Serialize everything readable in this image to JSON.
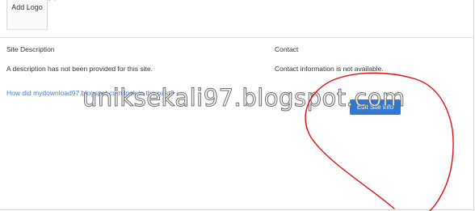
{
  "logo": {
    "plus_glyph": "+",
    "label": "Add Logo"
  },
  "top_fragment": "y          p",
  "site_description": {
    "heading": "Site Description",
    "text": "A description has not been provided for this site."
  },
  "contact": {
    "heading": "Contact",
    "text": "Contact information is not available."
  },
  "past_link": "How did mydownload97.blogspot.com look in the past?",
  "edit_button": "Edit Site Info",
  "watermark": "uniksekali97.blogspot.com",
  "colors": {
    "link": "#3b7dd8",
    "button_bg": "#2f79d4",
    "annotation": "#e01010"
  }
}
